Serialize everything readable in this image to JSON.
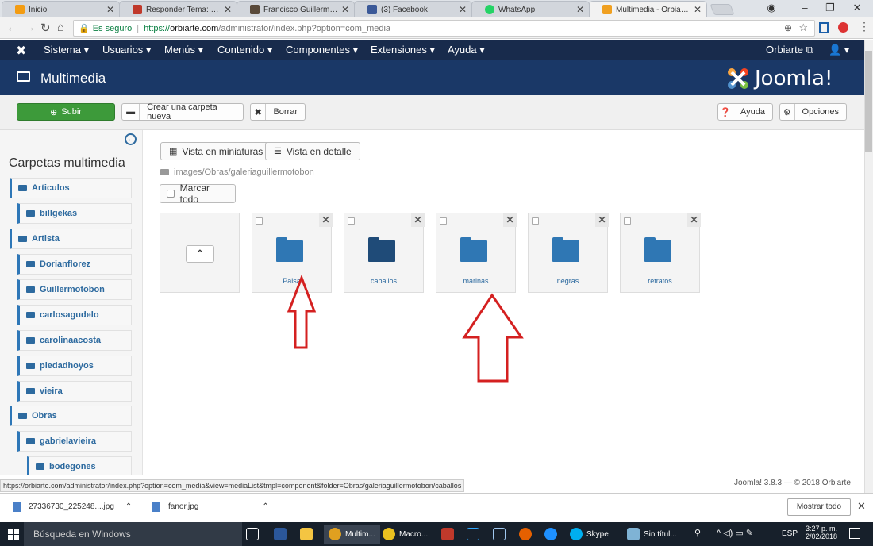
{
  "browser": {
    "tabs": [
      {
        "title": "Inicio",
        "color": "#f39c12"
      },
      {
        "title": "Responder Tema: Modul",
        "color": "#c0392b"
      },
      {
        "title": "Francisco Guillermo Tobó",
        "color": "#5a4a3a"
      },
      {
        "title": "(3) Facebook",
        "color": "#3b5998"
      },
      {
        "title": "WhatsApp",
        "color": "#25d366"
      },
      {
        "title": "Multimedia - Orbiarte - A",
        "color": "#f0a020"
      }
    ],
    "secure_label": "Es seguro",
    "url_proto": "https://",
    "url_host": "orbiarte.com",
    "url_path": "/administrator/index.php?option=com_media"
  },
  "jnav": {
    "items": [
      "Sistema",
      "Usuarios",
      "Menús",
      "Contenido",
      "Componentes",
      "Extensiones",
      "Ayuda"
    ],
    "site_link": "Orbiarte",
    "user_icon": "user-icon"
  },
  "header": {
    "title": "Multimedia",
    "logo_text": "Joomla!"
  },
  "toolbar": {
    "upload": "Subir",
    "new_folder": "Crear una carpeta nueva",
    "delete": "Borrar",
    "help": "Ayuda",
    "options": "Opciones"
  },
  "sidebar": {
    "title": "Carpetas multimedia",
    "items": [
      {
        "label": "Articulos",
        "level": 0
      },
      {
        "label": "billgekas",
        "level": 1
      },
      {
        "label": "Artista",
        "level": 0
      },
      {
        "label": "Dorianflorez",
        "level": 1
      },
      {
        "label": "Guillermotobon",
        "level": 1
      },
      {
        "label": "carlosagudelo",
        "level": 1
      },
      {
        "label": "carolinaacosta",
        "level": 1
      },
      {
        "label": "piedadhoyos",
        "level": 1
      },
      {
        "label": "vieira",
        "level": 1
      },
      {
        "label": "Obras",
        "level": 0
      },
      {
        "label": "gabrielavieira",
        "level": 1
      },
      {
        "label": "bodegones",
        "level": 2
      }
    ]
  },
  "main": {
    "view_thumbs": "Vista en miniaturas",
    "view_detail": "Vista en detalle",
    "path": "images/Obras/galeriaguillermotobon",
    "select_all": "Marcar todo",
    "folders": [
      {
        "name": "Paisa",
        "hovered": false
      },
      {
        "name": "caballos",
        "hovered": true
      },
      {
        "name": "marinas",
        "hovered": false
      },
      {
        "name": "negras",
        "hovered": false
      },
      {
        "name": "retratos",
        "hovered": false
      }
    ]
  },
  "status": {
    "url": "https://orbiarte.com/administrator/index.php?option=com_media&view=mediaList&tmpl=component&folder=Obras/galeriaguillermotobon/caballos",
    "footer": "Joomla! 3.8.3 — © 2018 Orbiarte"
  },
  "downloads": {
    "items": [
      "27336730_225248....jpg",
      "fanor.jpg"
    ],
    "show_all": "Mostrar todo"
  },
  "taskbar": {
    "search": "Búsqueda en Windows",
    "apps": [
      "Multim...",
      "Macro...",
      "Skype",
      "Sin títul..."
    ],
    "lang": "ESP",
    "time": "3:27 p. m.",
    "date": "2/02/2018"
  },
  "colors": {
    "joomla_nav": "#182b4c",
    "joomla_header": "#1a3867",
    "folder_blue": "#2f77b4",
    "folder_dark": "#1f4b78",
    "subir_green": "#3d9a3a",
    "annotation_red": "#d42020"
  }
}
